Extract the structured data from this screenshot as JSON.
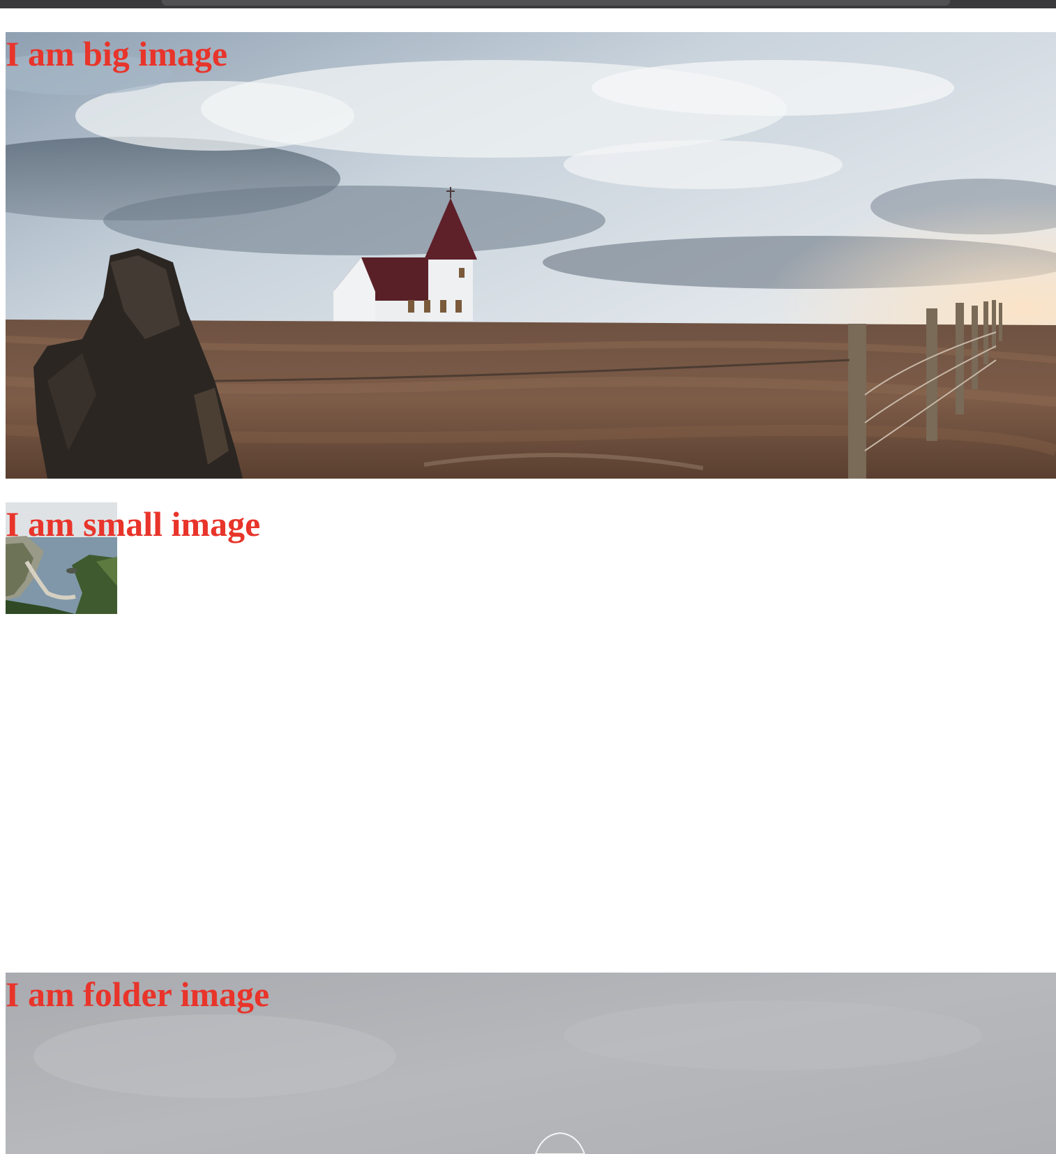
{
  "sections": {
    "big": {
      "label": "I am big image"
    },
    "small": {
      "label": "I am small image"
    },
    "folder": {
      "label": "I am folder image"
    }
  },
  "colors": {
    "label_text": "#e8342a",
    "page_background": "#ffffff",
    "top_bar": "#3a3a3c"
  }
}
